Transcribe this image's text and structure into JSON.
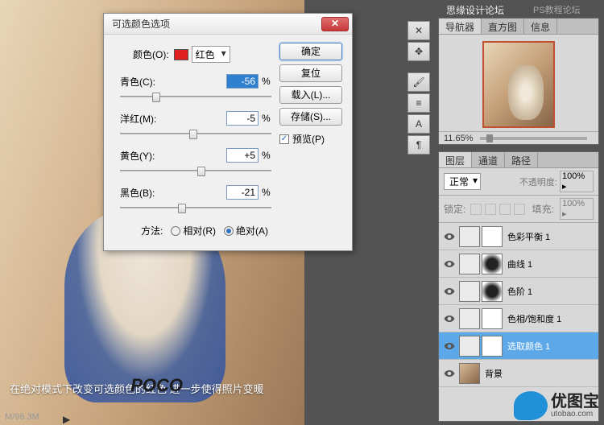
{
  "dialog": {
    "title": "可选颜色选项",
    "color_label": "颜色(O):",
    "color_name": "红色",
    "sliders": {
      "cyan": {
        "label": "青色(C):",
        "value": "-56",
        "pct": "%"
      },
      "magenta": {
        "label": "洋红(M):",
        "value": "-5",
        "pct": "%"
      },
      "yellow": {
        "label": "黄色(Y):",
        "value": "+5",
        "pct": "%"
      },
      "black": {
        "label": "黑色(B):",
        "value": "-21",
        "pct": "%"
      }
    },
    "method_label": "方法:",
    "method_relative": "相对(R)",
    "method_absolute": "绝对(A)",
    "buttons": {
      "ok": "确定",
      "cancel": "复位",
      "load": "载入(L)...",
      "save": "存储(S)..."
    },
    "preview": "预览(P)"
  },
  "canvas": {
    "caption": "在绝对模式下改变可选颜色的红色 进一步使得照片变暖",
    "brand": "POCO",
    "status": "M/96.3M"
  },
  "header": {
    "site1": "思缘设计论坛",
    "site2": "PS教程论坛"
  },
  "navigator": {
    "tabs": {
      "nav": "导航器",
      "histogram": "直方图",
      "info": "信息"
    },
    "zoom": "11.65%"
  },
  "layers": {
    "tabs": {
      "layers": "图层",
      "channels": "通道",
      "paths": "路径"
    },
    "blend": "正常",
    "opacity_label": "不透明度:",
    "opacity_value": "100% ▸",
    "lock_label": "锁定:",
    "fill_label": "填充:",
    "fill_value": "100% ▸",
    "items": [
      {
        "name": "色彩平衡 1",
        "mask": "plain"
      },
      {
        "name": "曲线 1",
        "mask": "dark"
      },
      {
        "name": "色阶 1",
        "mask": "dark"
      },
      {
        "name": "色相/饱和度 1",
        "mask": "plain"
      },
      {
        "name": "选取颜色 1",
        "mask": "plain",
        "selected": true
      },
      {
        "name": "背景",
        "bg": true
      }
    ]
  },
  "watermark": {
    "name": "优图宝",
    "url": "utobao.com"
  }
}
